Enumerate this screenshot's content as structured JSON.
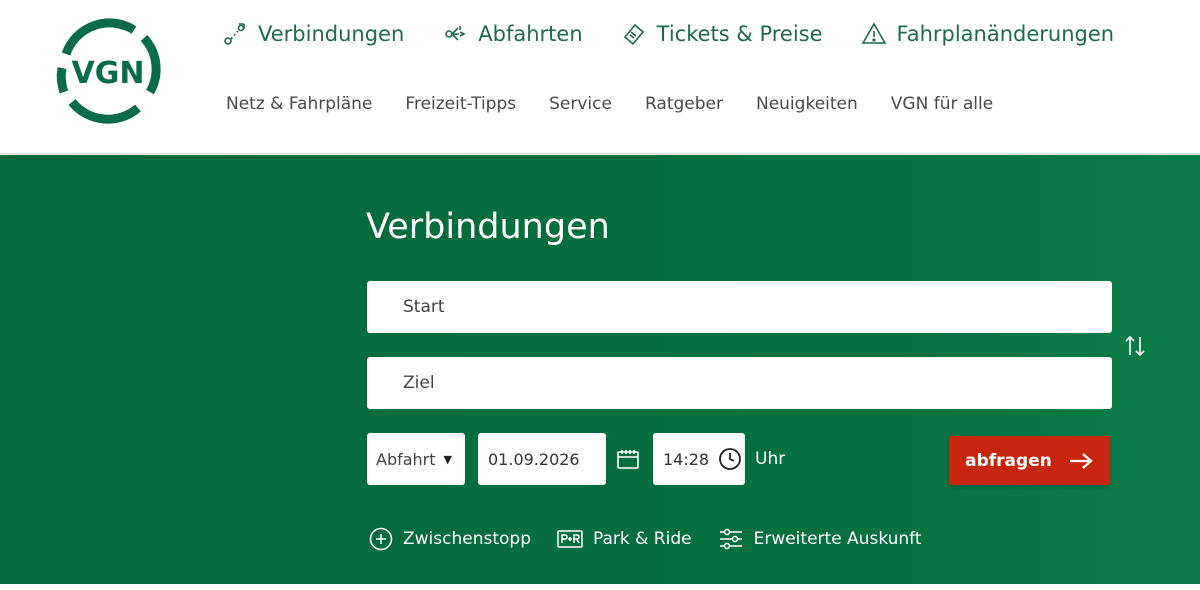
{
  "brand": {
    "logo_text": "VGN",
    "color": "#0a6b48"
  },
  "primary_nav": [
    {
      "label": "Verbindungen",
      "icon": "route-icon"
    },
    {
      "label": "Abfahrten",
      "icon": "departures-icon"
    },
    {
      "label": "Tickets & Preise",
      "icon": "ticket-icon"
    },
    {
      "label": "Fahrplanänderungen",
      "icon": "warning-icon"
    }
  ],
  "secondary_nav": [
    {
      "label": "Netz & Fahrpläne"
    },
    {
      "label": "Freizeit-Tipps"
    },
    {
      "label": "Service"
    },
    {
      "label": "Ratgeber"
    },
    {
      "label": "Neuigkeiten"
    },
    {
      "label": "VGN für alle"
    }
  ],
  "search": {
    "title": "Verbindungen",
    "start_placeholder": "Start",
    "ziel_placeholder": "Ziel",
    "mode_value": "Abfahrt",
    "date_value": "01.09.2026",
    "time_value": "14:28",
    "time_unit": "Uhr",
    "submit_label": "abfragen"
  },
  "options": [
    {
      "label": "Zwischenstopp",
      "icon": "plus-circle-icon"
    },
    {
      "label": "Park & Ride",
      "icon": "park-ride-icon"
    },
    {
      "label": "Erweiterte Auskunft",
      "icon": "sliders-icon"
    }
  ],
  "colors": {
    "primary_green": "#06713f",
    "nav_green": "#1e6a4a",
    "submit_red": "#c8250f"
  }
}
